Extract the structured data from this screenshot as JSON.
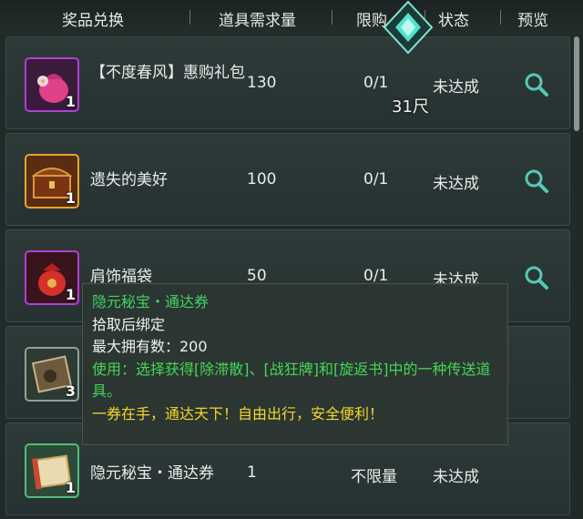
{
  "header": {
    "columns": [
      "奖品兑换",
      "道具需求量",
      "限购",
      "状态",
      "预览"
    ]
  },
  "rows": [
    {
      "name": "【不度春风】惠购礼包",
      "qty": "1",
      "required": "130",
      "limit": "0/1",
      "status": "未达成",
      "icon": "pink-gift-bag-icon"
    },
    {
      "name": "遗失的美好",
      "qty": "1",
      "required": "100",
      "limit": "0/1",
      "status": "未达成",
      "icon": "treasure-chest-icon"
    },
    {
      "name": "肩饰福袋",
      "qty": "1",
      "required": "50",
      "limit": "0/1",
      "status": "未达成",
      "icon": "red-lucky-bag-icon"
    },
    {
      "name": "",
      "qty": "3",
      "required": "",
      "limit": "",
      "status": "",
      "icon": "scroll-token-icon"
    },
    {
      "name": "隐元秘宝・通达券",
      "qty": "1",
      "required": "1",
      "limit": "不限量",
      "status": "未达成",
      "icon": "scroll-ticket-icon"
    }
  ],
  "marker": {
    "distance": "31尺"
  },
  "tooltip": {
    "title": "隐元秘宝・通达券",
    "bind": "拾取后绑定",
    "max_own": "最大拥有数：200",
    "desc": "使用：选择获得[除滞散]、[战狂牌]和[旋返书]中的一种传送道具。",
    "flavor": "一券在手，通达天下！自由出行，安全便利！"
  },
  "colors": {
    "accent_green": "#46d659",
    "flavor_yellow": "#f4d82a",
    "marker_teal": "#4fe3cf"
  }
}
